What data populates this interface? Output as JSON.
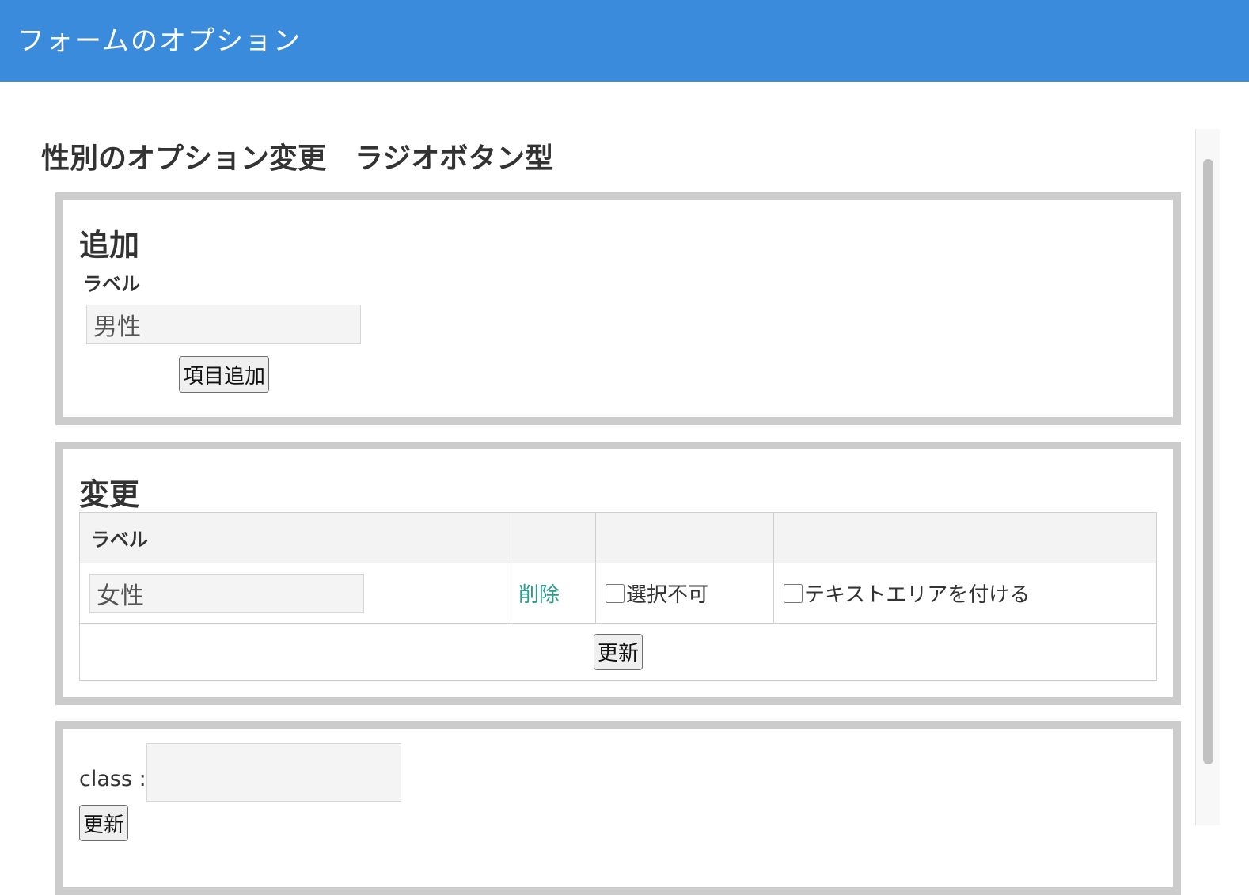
{
  "header": {
    "title": "フォームのオプション"
  },
  "page": {
    "title": "性別のオプション変更　ラジオボタン型"
  },
  "add_panel": {
    "heading": "追加",
    "label_caption": "ラベル",
    "label_value": "男性",
    "add_button": "項目追加"
  },
  "edit_panel": {
    "heading": "変更",
    "table": {
      "headers": [
        "ラベル",
        "",
        "",
        ""
      ],
      "rows": [
        {
          "label_value": "女性",
          "delete_link": "削除",
          "disable_checkbox": {
            "label": "選択不可",
            "checked": false
          },
          "textarea_checkbox": {
            "label": "テキストエリアを付ける",
            "checked": false
          }
        }
      ]
    },
    "update_button": "更新"
  },
  "class_panel": {
    "class_label": "class :",
    "class_value": "",
    "update_button": "更新"
  },
  "colors": {
    "header_bg": "#3a8bdb",
    "panel_border": "#cccccc",
    "link": "#2a9d8f"
  }
}
